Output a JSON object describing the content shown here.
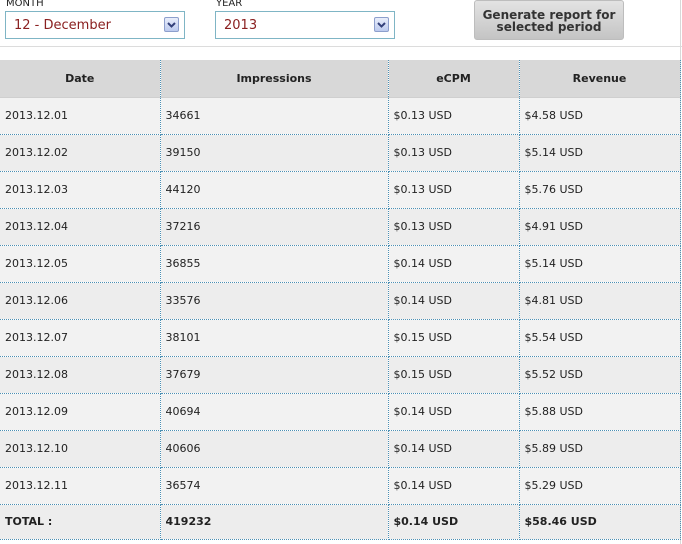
{
  "filters": {
    "month_label": "MONTH",
    "month_value": "12 - December",
    "year_label": "YEAR",
    "year_value": "2013",
    "generate_button": "Generate report for\nselected period"
  },
  "table": {
    "headers": [
      "Date",
      "Impressions",
      "eCPM",
      "Revenue"
    ],
    "rows": [
      [
        "2013.12.01",
        "34661",
        "$0.13 USD",
        "$4.58 USD"
      ],
      [
        "2013.12.02",
        "39150",
        "$0.13 USD",
        "$5.14 USD"
      ],
      [
        "2013.12.03",
        "44120",
        "$0.13 USD",
        "$5.76 USD"
      ],
      [
        "2013.12.04",
        "37216",
        "$0.13 USD",
        "$4.91 USD"
      ],
      [
        "2013.12.05",
        "36855",
        "$0.14 USD",
        "$5.14 USD"
      ],
      [
        "2013.12.06",
        "33576",
        "$0.14 USD",
        "$4.81 USD"
      ],
      [
        "2013.12.07",
        "38101",
        "$0.15 USD",
        "$5.54 USD"
      ],
      [
        "2013.12.08",
        "37679",
        "$0.15 USD",
        "$5.52 USD"
      ],
      [
        "2013.12.09",
        "40694",
        "$0.14 USD",
        "$5.88 USD"
      ],
      [
        "2013.12.10",
        "40606",
        "$0.14 USD",
        "$5.89 USD"
      ],
      [
        "2013.12.11",
        "36574",
        "$0.14 USD",
        "$5.29 USD"
      ]
    ],
    "total": [
      "TOTAL :",
      "419232",
      "$0.14 USD",
      "$58.46 USD"
    ]
  },
  "icons": {
    "dropdown": "chevron-down-icon"
  },
  "colors": {
    "select_text": "#8a2020",
    "select_border": "#7fb5c5",
    "header_bg": "#d8d8d8",
    "row_bg": "#f2f2f2",
    "cell_border": "#4b8fb3"
  }
}
